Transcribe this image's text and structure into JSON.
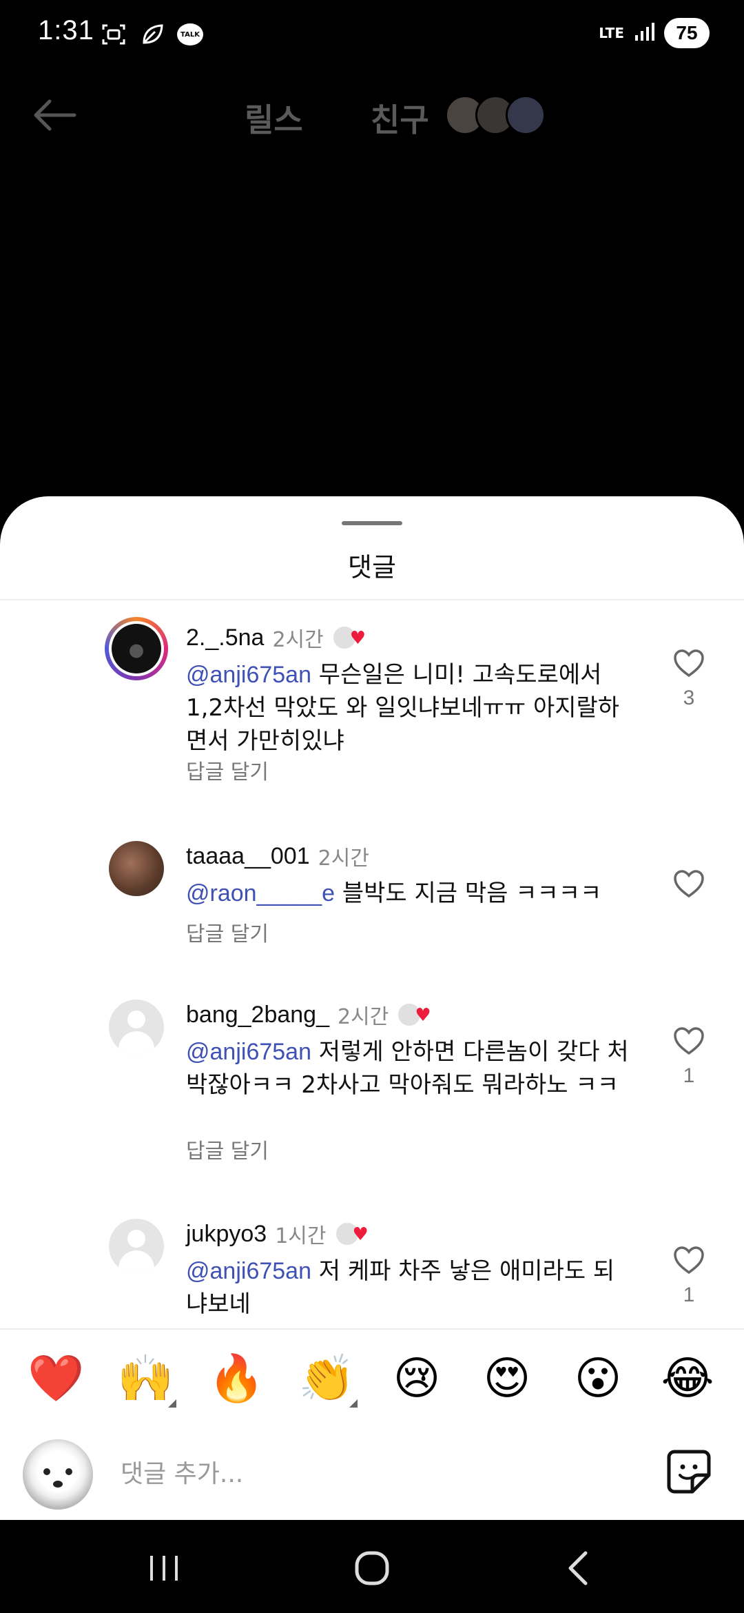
{
  "status_bar": {
    "time": "1:31",
    "network": "LTE",
    "battery": "75"
  },
  "top_nav": {
    "tab_reels": "릴스",
    "tab_friends": "친구"
  },
  "sheet": {
    "title": "댓글"
  },
  "comments": [
    {
      "username": "2._.5na",
      "time": "2시간",
      "creator_liked": true,
      "mention": "@anji675an",
      "text": " 무슨일은 니미! 고속도로에서 1,2차선 막았도 와 일잇냐보네ㅠㅠ 아지랄하면서 가만히있냐",
      "reply_label": "답글 달기",
      "like_count": "3"
    },
    {
      "username": "taaaa__001",
      "time": "2시간",
      "creator_liked": false,
      "mention": "@raon_____e",
      "text": " 블박도 지금 막음 ㅋㅋㅋㅋ",
      "reply_label": "답글 달기",
      "like_count": ""
    },
    {
      "username": "bang_2bang_",
      "time": "2시간",
      "creator_liked": true,
      "mention": "@anji675an",
      "text": " 저렇게 안하면 다른놈이 갖다 처박잖아ㅋㅋ 2차사고 막아줘도 뭐라하노 ㅋㅋ",
      "reply_label": "답글 달기",
      "like_count": "1"
    },
    {
      "username": "jukpyo3",
      "time": "1시간",
      "creator_liked": true,
      "mention": "@anji675an",
      "text": " 저 케파 차주 낳은 애미라도 되냐보네",
      "reply_label": "",
      "like_count": "1"
    }
  ],
  "emoji_bar": [
    "❤️",
    "🙌",
    "🔥",
    "👏",
    "😢",
    "😍",
    "😮",
    "😂"
  ],
  "input": {
    "placeholder": "댓글 추가..."
  },
  "colors": {
    "mention": "#3f51b5",
    "heart": "#ed1c3c"
  }
}
